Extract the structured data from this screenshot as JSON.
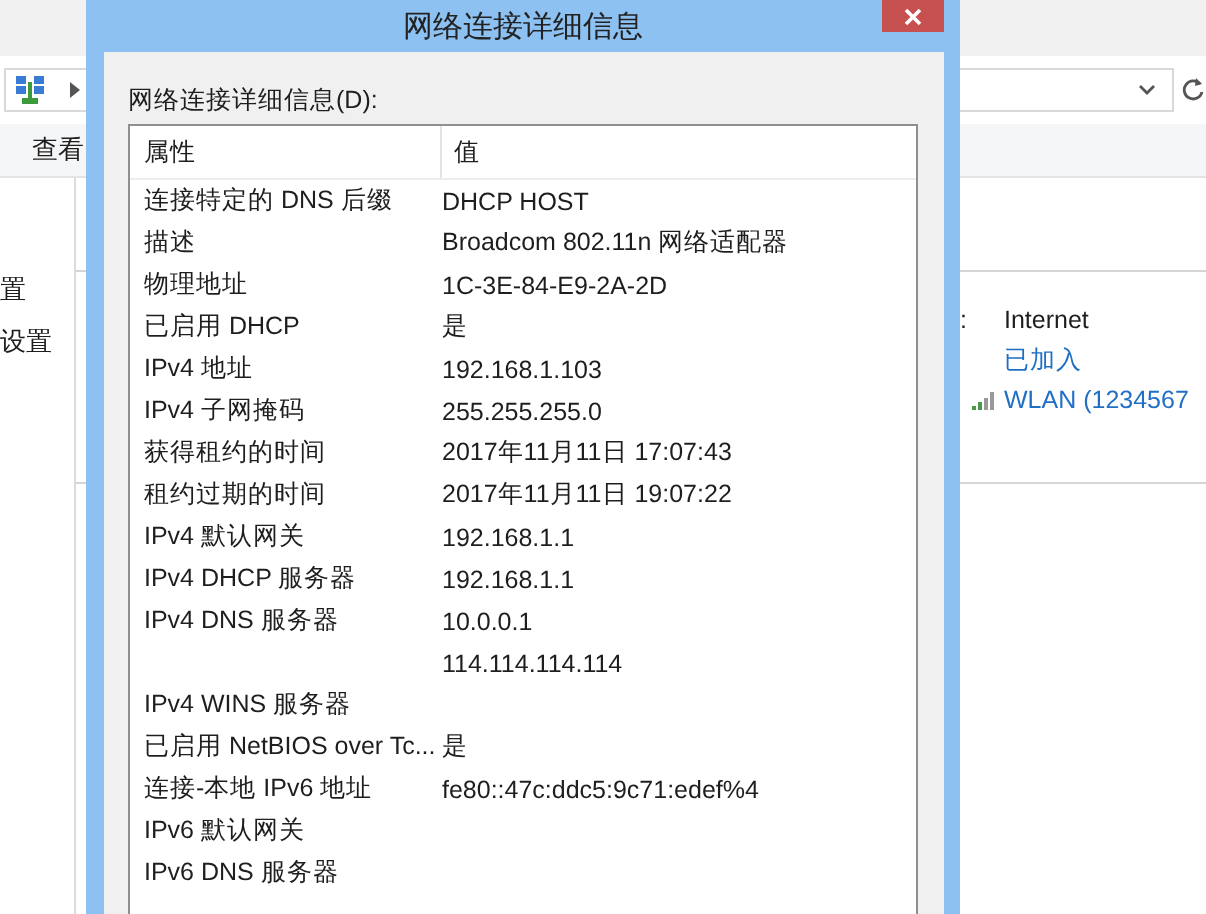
{
  "explorer": {
    "ribbon_tab": "查看",
    "nav_items": [
      "置",
      "设置"
    ],
    "access_colon": ":",
    "access_value": "Internet",
    "status_link": "已加入",
    "network_link": "WLAN (1234567"
  },
  "dialog": {
    "title": "网络连接详细信息",
    "list_label": "网络连接详细信息(D):",
    "columns": [
      "属性",
      "值"
    ],
    "rows": [
      {
        "property": "连接特定的 DNS 后缀",
        "value": "DHCP HOST"
      },
      {
        "property": "描述",
        "value": "Broadcom 802.11n 网络适配器"
      },
      {
        "property": "物理地址",
        "value": "1C-3E-84-E9-2A-2D"
      },
      {
        "property": "已启用 DHCP",
        "value": "是"
      },
      {
        "property": "IPv4 地址",
        "value": "192.168.1.103"
      },
      {
        "property": "IPv4 子网掩码",
        "value": "255.255.255.0"
      },
      {
        "property": "获得租约的时间",
        "value": "2017年11月11日 17:07:43"
      },
      {
        "property": "租约过期的时间",
        "value": "2017年11月11日 19:07:22"
      },
      {
        "property": "IPv4 默认网关",
        "value": "192.168.1.1"
      },
      {
        "property": "IPv4 DHCP 服务器",
        "value": "192.168.1.1"
      },
      {
        "property": "IPv4 DNS 服务器",
        "value": "10.0.0.1"
      },
      {
        "value": "114.114.114.114"
      },
      {
        "property": "IPv4 WINS 服务器"
      },
      {
        "property": "已启用 NetBIOS over Tc...",
        "value": "是"
      },
      {
        "property": "连接-本地 IPv6 地址",
        "value": "fe80::47c:ddc5:9c71:edef%4"
      },
      {
        "property": "IPv6 默认网关"
      },
      {
        "property": "IPv6 DNS 服务器"
      }
    ]
  }
}
